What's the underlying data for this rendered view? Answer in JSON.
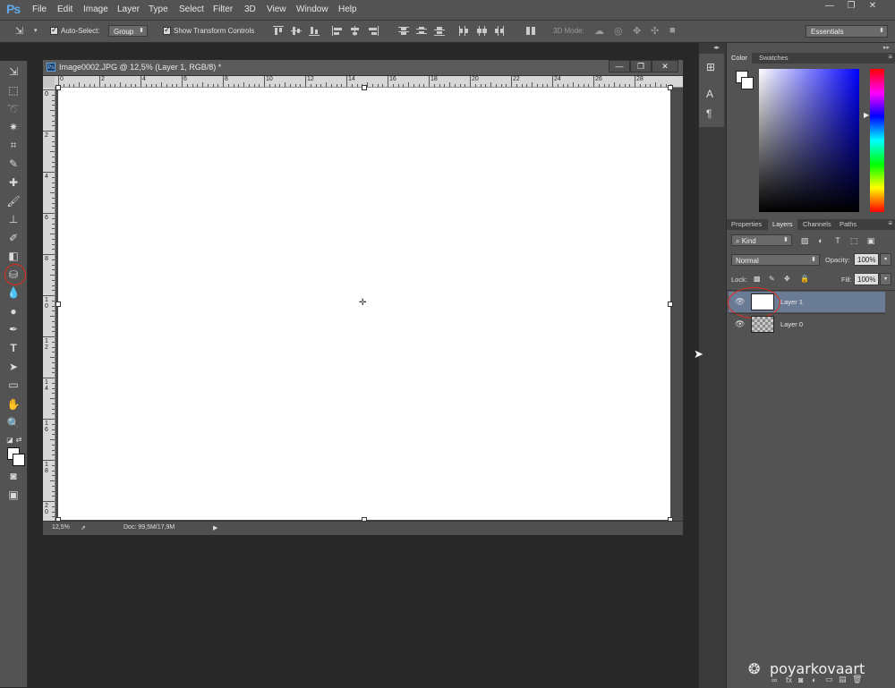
{
  "app": {
    "logo": "Ps"
  },
  "menu": [
    "File",
    "Edit",
    "Image",
    "Layer",
    "Type",
    "Select",
    "Filter",
    "3D",
    "View",
    "Window",
    "Help"
  ],
  "window_controls": {
    "minimize": "—",
    "restore": "❐",
    "close": "✕"
  },
  "options_bar": {
    "auto_select_label": "Auto-Select:",
    "auto_select_value": "Group",
    "show_transform_label": "Show Transform Controls",
    "mode_3d_label": "3D Mode:",
    "workspace": "Essentials"
  },
  "document": {
    "title": "Image0002.JPG @ 12,5% (Layer 1, RGB/8) *",
    "zoom": "12,5%",
    "doc_info": "Doc: 99,5M/17,9M",
    "ruler_top": [
      "0",
      "2",
      "4",
      "6",
      "8",
      "10",
      "12",
      "14",
      "16",
      "18",
      "20",
      "22",
      "24",
      "26",
      "28"
    ],
    "ruler_left": [
      "0",
      "2",
      "4",
      "6",
      "8",
      "1\n0",
      "1\n2",
      "1\n4",
      "1\n6",
      "1\n8",
      "2\n0"
    ],
    "canvas_color": "#ffffff"
  },
  "panels": {
    "color_tabs": [
      "Color",
      "Swatches"
    ],
    "layer_tabs": [
      "Properties",
      "Layers",
      "Channels",
      "Paths"
    ],
    "filter_kind": "Kind",
    "blend_mode": "Normal",
    "opacity_label": "Opacity:",
    "opacity_value": "100%",
    "lock_label": "Lock:",
    "fill_label": "Fill:",
    "fill_value": "100%",
    "layers": [
      {
        "name": "Layer 1",
        "selected": true,
        "thumb": "white"
      },
      {
        "name": "Layer 0",
        "selected": false,
        "thumb": "transparent"
      }
    ]
  },
  "watermark": "poyarkovaart",
  "colors": {
    "selected_layer": "#6a7b95",
    "annotation": "#e02a1a"
  }
}
